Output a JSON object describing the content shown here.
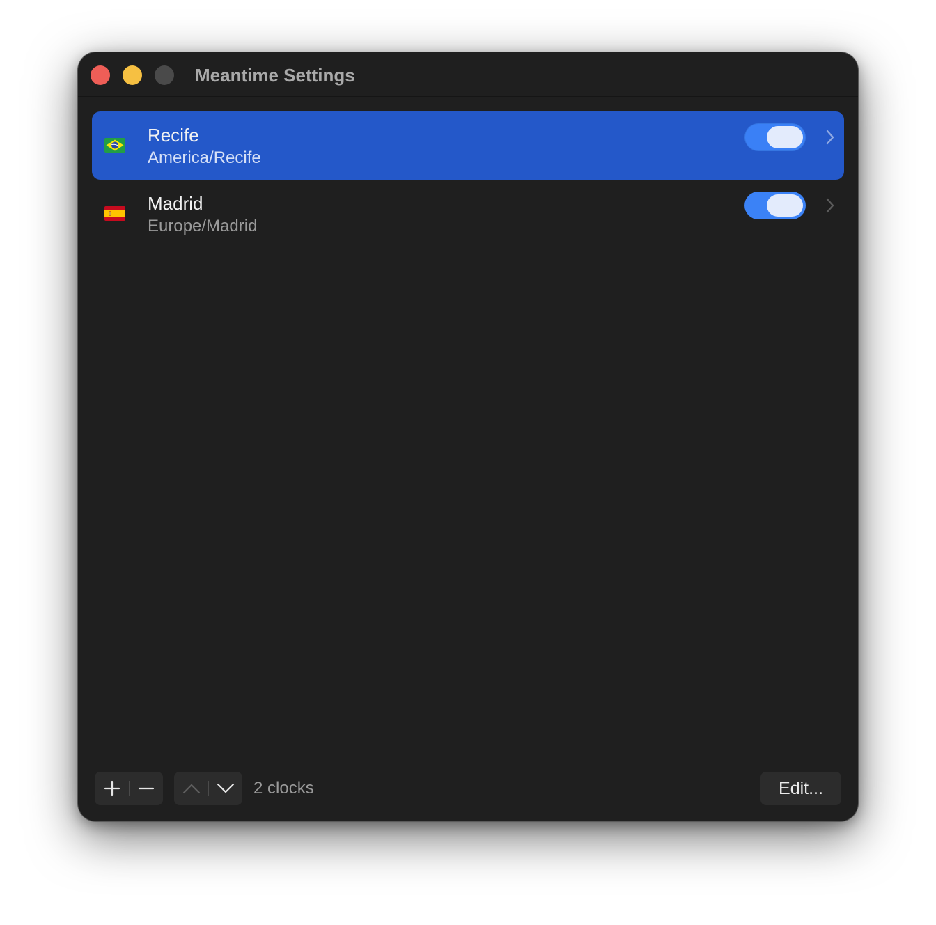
{
  "window": {
    "title": "Meantime Settings"
  },
  "clocks": [
    {
      "city": "Recife",
      "timezone": "America/Recife",
      "flag": "brazil-flag-icon",
      "enabled": true,
      "selected": true
    },
    {
      "city": "Madrid",
      "timezone": "Europe/Madrid",
      "flag": "spain-flag-icon",
      "enabled": true,
      "selected": false
    }
  ],
  "footer": {
    "count_label": "2 clocks",
    "edit_label": "Edit..."
  },
  "colors": {
    "window_background": "#1f1f1f",
    "selection": "#2458c9",
    "toggle_on": "#3b82f6",
    "close": "#ee5e57",
    "minimize": "#f6c042",
    "zoom_disabled": "#4a4a4a"
  },
  "icons": {
    "add": "plus-icon",
    "remove": "minus-icon",
    "move_up": "chevron-up-icon",
    "move_down": "chevron-down-icon",
    "disclosure": "chevron-right-icon"
  }
}
